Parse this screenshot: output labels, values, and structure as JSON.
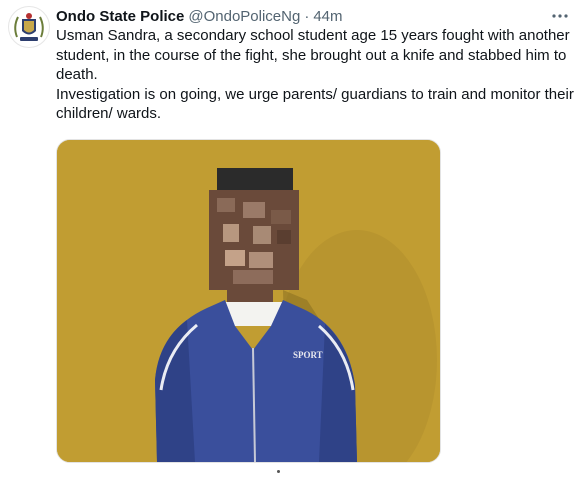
{
  "tweet": {
    "author_name": "Ondo State Police",
    "handle": "@OndoPoliceNg",
    "separator": "·",
    "time": "44m",
    "paragraphs": [
      "Usman Sandra, a secondary school student age 15 years fought with another student, in the course of the fight, she brought out a knife and stabbed him to death.",
      "Investigation is on going, we urge parents/ guardians to train and monitor their children/ wards."
    ]
  },
  "media": {
    "jacket_text": "SPORT",
    "wall_color": "#c7a235",
    "jacket_color": "#3a4f9c"
  },
  "icons": {
    "avatar": "police-crest-icon",
    "more": "more-options-icon"
  }
}
